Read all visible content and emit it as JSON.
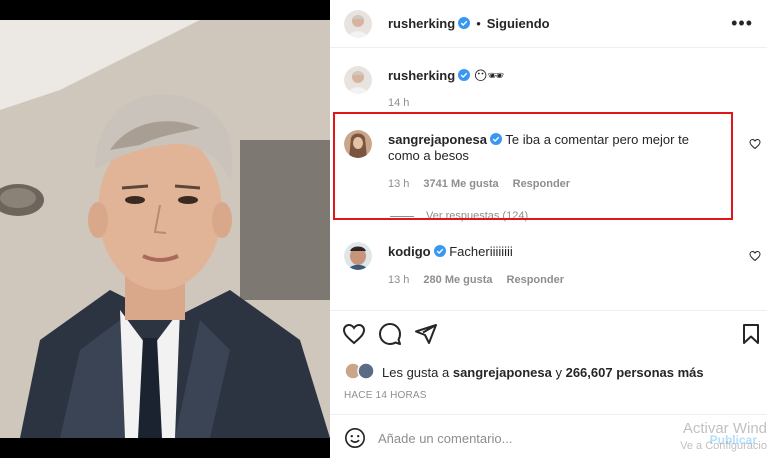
{
  "post": {
    "author": "rusherking",
    "follow_status": "Siguiendo",
    "caption_emojis": "😶🕶"
  },
  "header": {
    "separator": "•",
    "more_glyph": "•••"
  },
  "caption": {
    "user": "rusherking",
    "time": "14 h"
  },
  "comments": [
    {
      "user": "sangrejaponesa",
      "text": "Te iba a comentar pero mejor te como a besos",
      "time": "13 h",
      "likes": "3741 Me gusta",
      "reply_label": "Responder",
      "view_replies": "Ver respuestas (124)"
    },
    {
      "user": "kodigo",
      "text": "Facheriiiiiiii",
      "time": "13 h",
      "likes": "280 Me gusta",
      "reply_label": "Responder"
    }
  ],
  "likes": {
    "prefix": "Les gusta a",
    "user": "sangrejaponesa",
    "connector": "y",
    "count_text": "266,607 personas más"
  },
  "date": "HACE 14 HORAS",
  "add_comment": {
    "placeholder": "Añade un comentario...",
    "publish_label": "Publicar"
  },
  "watermark": {
    "title": "Activar Wind",
    "subtitle": "Ve a Configuracio"
  },
  "icons": {
    "verified": "verified-badge-icon",
    "heart": "heart-icon",
    "comment": "comment-icon",
    "share": "share-icon",
    "save": "bookmark-icon",
    "emoji": "emoji-icon",
    "more": "more-options-icon"
  },
  "colors": {
    "verified_blue": "#3897f0",
    "highlight_red": "#e0161b",
    "publish_blue": "#b2dffc",
    "muted_gray": "#8e8e8e"
  }
}
